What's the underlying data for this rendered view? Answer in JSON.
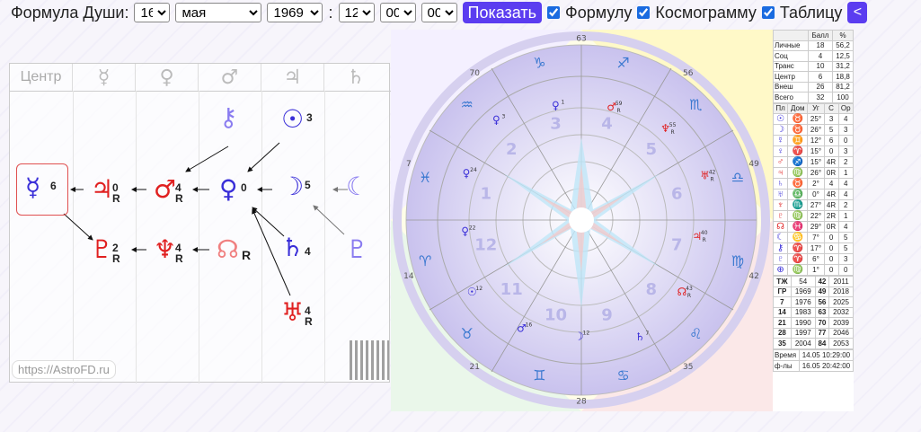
{
  "toolbar": {
    "title": "Формула Души:",
    "day": "16",
    "month": "мая",
    "year": "1969",
    "colon": ":",
    "hour": "12",
    "minute": "00",
    "second": "00",
    "show_button": "Показать",
    "check_formula": "Формулу",
    "check_cosmogram": "Космограмму",
    "check_table": "Таблицу",
    "back_button": "<"
  },
  "formula": {
    "columns": [
      "Центр",
      "☿",
      "♀",
      "♂",
      "♃",
      "♄"
    ],
    "site": "https://AstroFD.ru",
    "nodes": [
      {
        "glyph": "☿",
        "color": "#3a2fd8",
        "sup": "6",
        "sub": ""
      },
      {
        "glyph": "♃",
        "color": "#e02020",
        "sup": "0",
        "sub": "R"
      },
      {
        "glyph": "♂",
        "color": "#e02020",
        "sup": "4",
        "sub": "R"
      },
      {
        "glyph": "♀",
        "color": "#3a2fd8",
        "sup": "0",
        "sub": ""
      },
      {
        "glyph": "☽",
        "color": "#3a2fd8",
        "sup": "5",
        "sub": ""
      },
      {
        "glyph": "☾",
        "color": "#8a7cf0",
        "sup": "",
        "sub": ""
      },
      {
        "glyph": "⚷",
        "color": "#8a7cf0",
        "sup": "",
        "sub": ""
      },
      {
        "glyph": "☉",
        "color": "#3a2fd8",
        "sup": "3",
        "sub": ""
      },
      {
        "glyph": "♇",
        "color": "#e02020",
        "sup": "2",
        "sub": "R"
      },
      {
        "glyph": "♆",
        "color": "#e02020",
        "sup": "4",
        "sub": "R"
      },
      {
        "glyph": "☊",
        "color": "#f08080",
        "sup": "",
        "sub": "R"
      },
      {
        "glyph": "♄",
        "color": "#3a2fd8",
        "sup": "4",
        "sub": ""
      },
      {
        "glyph": "♇",
        "color": "#8a7cf0",
        "sup": "",
        "sub": ""
      },
      {
        "glyph": "♅",
        "color": "#e02020",
        "sup": "4",
        "sub": "R"
      }
    ]
  },
  "chart": {
    "degree_marks": [
      "63",
      "56",
      "49",
      "42",
      "35",
      "28",
      "21",
      "14",
      "7",
      "70"
    ],
    "house_numbers": [
      "1",
      "2",
      "3",
      "4",
      "5",
      "6",
      "7",
      "8",
      "9",
      "10",
      "11",
      "12"
    ],
    "zodiac": [
      "♈",
      "♉",
      "♊",
      "♋",
      "♌",
      "♍",
      "♎",
      "♏",
      "♐",
      "♑",
      "♒",
      "♓"
    ],
    "planet_labels": [
      {
        "g": "♂",
        "n": "59",
        "r": "R"
      },
      {
        "g": "♆",
        "n": "55",
        "r": "R"
      },
      {
        "g": "♅",
        "n": "42",
        "r": "R"
      },
      {
        "g": "♃",
        "n": "40",
        "r": "R"
      },
      {
        "g": "☊",
        "n": "43",
        "r": "R"
      },
      {
        "g": "♄",
        "n": "7",
        "r": ""
      },
      {
        "g": "☽",
        "n": "12",
        "r": ""
      },
      {
        "g": "♂",
        "n": "16",
        "r": ""
      },
      {
        "g": "☉",
        "n": "12",
        "r": ""
      },
      {
        "g": "♀",
        "n": "22",
        "r": ""
      },
      {
        "g": "♀",
        "n": "24",
        "r": ""
      },
      {
        "g": "♀",
        "n": "3",
        "r": ""
      },
      {
        "g": "♀",
        "n": "1",
        "r": ""
      }
    ]
  },
  "table": {
    "head": [
      "",
      "Балл",
      "%"
    ],
    "scores": [
      [
        "Личные",
        "18",
        "56,2"
      ],
      [
        "Соц",
        "4",
        "12,5"
      ],
      [
        "Транс",
        "10",
        "31,2"
      ],
      [
        "Центр",
        "6",
        "18,8"
      ],
      [
        "Внеш",
        "26",
        "81,2"
      ],
      [
        "Всего",
        "32",
        "100"
      ]
    ],
    "planets_head": [
      "Пл",
      "Дом",
      "Уг",
      "С",
      "Ор"
    ],
    "planets": [
      [
        "☉",
        "♉",
        "25°",
        "3",
        "4"
      ],
      [
        "☽",
        "♉",
        "26°",
        "5",
        "3"
      ],
      [
        "☿",
        "♊",
        "12°",
        "6",
        "0"
      ],
      [
        "♀",
        "♈",
        "15°",
        "0",
        "3"
      ],
      [
        "♂",
        "♐",
        "15°",
        "4R",
        "2"
      ],
      [
        "♃",
        "♍",
        "26°",
        "0R",
        "1"
      ],
      [
        "♄",
        "♉",
        "2°",
        "4",
        "4"
      ],
      [
        "♅",
        "♎",
        "0°",
        "4R",
        "4"
      ],
      [
        "♆",
        "♏",
        "27°",
        "4R",
        "2"
      ],
      [
        "♇",
        "♍",
        "22°",
        "2R",
        "1"
      ],
      [
        "☊",
        "♓",
        "29°",
        "0R",
        "4"
      ],
      [
        "☾",
        "♋",
        "7°",
        "0",
        "5"
      ],
      [
        "⚷",
        "♈",
        "17°",
        "0",
        "5"
      ],
      [
        "♇",
        "♈",
        "6°",
        "0",
        "3"
      ],
      [
        "⊕",
        "♍",
        "1°",
        "0",
        "0"
      ]
    ],
    "periods": [
      [
        "ТЖ",
        "54",
        "42",
        "2011"
      ],
      [
        "ГР",
        "1969",
        "49",
        "2018"
      ],
      [
        "7",
        "1976",
        "56",
        "2025"
      ],
      [
        "14",
        "1983",
        "63",
        "2032"
      ],
      [
        "21",
        "1990",
        "70",
        "2039"
      ],
      [
        "28",
        "1997",
        "77",
        "2046"
      ],
      [
        "35",
        "2004",
        "84",
        "2053"
      ]
    ],
    "time_label": "Время",
    "time_value": "14.05 10:29:00",
    "formula_label": "ф-лы",
    "formula_value": "16.05 20:42:00"
  },
  "colors": {
    "accent": "#5b3df0",
    "personal": "#3a2fd8",
    "red": "#e02020",
    "light": "#8a7cf0"
  }
}
